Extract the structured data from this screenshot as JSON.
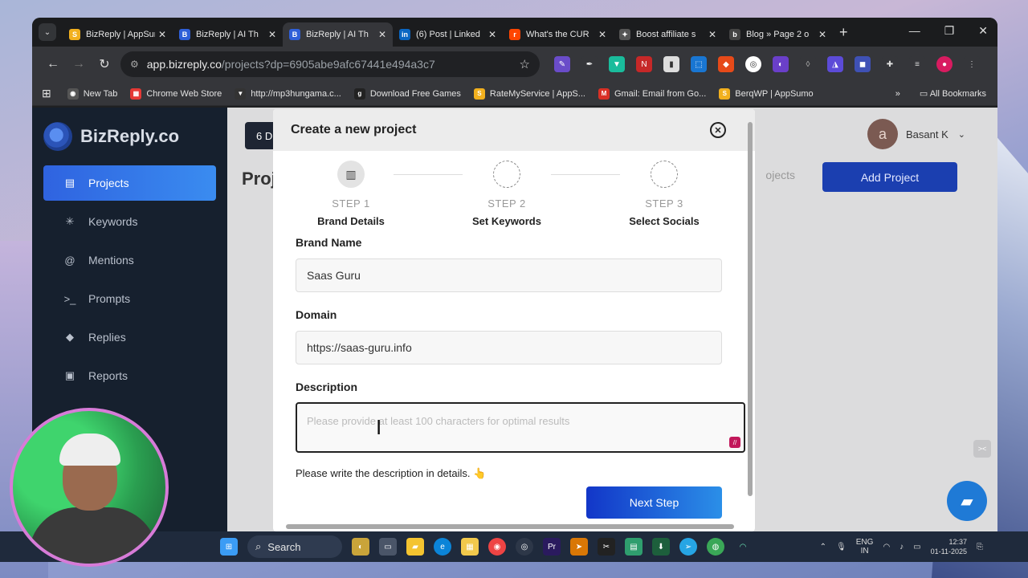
{
  "browser": {
    "tabs": [
      {
        "label": "BizReply | AppSumo",
        "fav_color": "#f2b01e",
        "fav_glyph": "S"
      },
      {
        "label": "BizReply | AI Th",
        "fav_color": "#2f5fd8",
        "fav_glyph": "B"
      },
      {
        "label": "BizReply | AI Th",
        "fav_color": "#2f5fd8",
        "fav_glyph": "B"
      },
      {
        "label": "(6) Post | Linked",
        "fav_color": "#0a66c2",
        "fav_glyph": "in"
      },
      {
        "label": "What's the CUR",
        "fav_color": "#ff4500",
        "fav_glyph": "r"
      },
      {
        "label": "Boost affiliate s",
        "fav_color": "#555",
        "fav_glyph": "✦"
      },
      {
        "label": "Blog » Page 2 o",
        "fav_color": "#444",
        "fav_glyph": "b"
      }
    ],
    "url_host": "app.bizreply.co",
    "url_path": "/projects?dp=6905abe9afc67441e494a3c7",
    "bookmarks": [
      {
        "label": "New Tab",
        "color": "#555",
        "glyph": "◉"
      },
      {
        "label": "Chrome Web Store",
        "color": "#e53935",
        "glyph": "▦"
      },
      {
        "label": "http://mp3hungama.c...",
        "color": "#333",
        "glyph": "▼"
      },
      {
        "label": "Download Free Games",
        "color": "#222",
        "glyph": "g"
      },
      {
        "label": "RateMyService | AppS...",
        "color": "#f2b01e",
        "glyph": "S"
      },
      {
        "label": "Gmail: Email from Go...",
        "color": "#d93025",
        "glyph": "M"
      },
      {
        "label": "BerqWP | AppSumo",
        "color": "#f2b01e",
        "glyph": "S"
      }
    ],
    "all_bookmarks": "All Bookmarks"
  },
  "sidebar": {
    "brand": "BizReply.co",
    "items": [
      {
        "label": "Projects",
        "icon": "projects-icon",
        "glyph": "▤"
      },
      {
        "label": "Keywords",
        "icon": "keywords-icon",
        "glyph": "✳"
      },
      {
        "label": "Mentions",
        "icon": "mentions-icon",
        "glyph": "@"
      },
      {
        "label": "Prompts",
        "icon": "prompts-icon",
        "glyph": ">_"
      },
      {
        "label": "Replies",
        "icon": "replies-icon",
        "glyph": "◆"
      },
      {
        "label": "Reports",
        "icon": "reports-icon",
        "glyph": "▣"
      }
    ]
  },
  "main": {
    "top_button": "6 D",
    "title": "Proj",
    "user_initial": "a",
    "user_name": "Basant K",
    "projects_link": "ojects",
    "add_project": "Add Project"
  },
  "modal": {
    "title": "Create a new project",
    "steps": [
      {
        "num": "STEP 1",
        "name": "Brand Details"
      },
      {
        "num": "STEP 2",
        "name": "Set Keywords"
      },
      {
        "num": "STEP 3",
        "name": "Select Socials"
      }
    ],
    "brand_name_label": "Brand Name",
    "brand_name_value": "Saas Guru",
    "domain_label": "Domain",
    "domain_value": "https://saas-guru.info",
    "description_label": "Description",
    "description_placeholder": "Please provide at least 100 characters for optimal results",
    "hint": "Please write the description in details. 👆",
    "next_button": "Next Step"
  },
  "taskbar": {
    "search": "Search",
    "lang_top": "ENG",
    "lang_bottom": "IN",
    "time": "12:37",
    "date": "01-11-2025"
  }
}
